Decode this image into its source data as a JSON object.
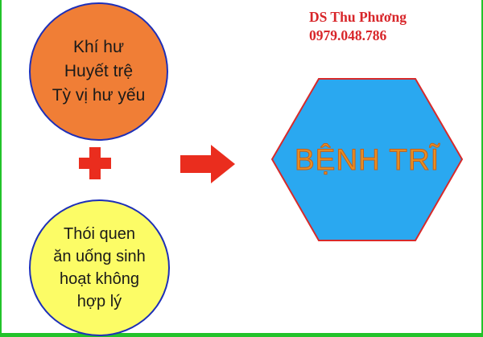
{
  "credit": {
    "name": "DS Thu Phương",
    "phone": "0979.048.786"
  },
  "causes": {
    "internal": [
      "Khí hư",
      "Huyết trệ",
      "Tỳ vị hư yếu"
    ],
    "lifestyle": [
      "Thói quen",
      "ăn uống sinh",
      "hoạt không",
      "hợp lý"
    ]
  },
  "result": {
    "label": "BỆNH TRĨ"
  },
  "colors": {
    "internal_fill": "#f07e36",
    "lifestyle_fill": "#fcfc66",
    "circle_border": "#1d2fb8",
    "plus_and_arrow": "#ea2d1e",
    "hexagon_fill": "#2aa8f0",
    "hexagon_border": "#d82a2a",
    "result_text": "#e88f22",
    "credit_text": "#d8262a",
    "frame": "#22c32a"
  },
  "icons": {
    "combine": "plus-icon",
    "leads_to": "arrow-right-icon"
  }
}
